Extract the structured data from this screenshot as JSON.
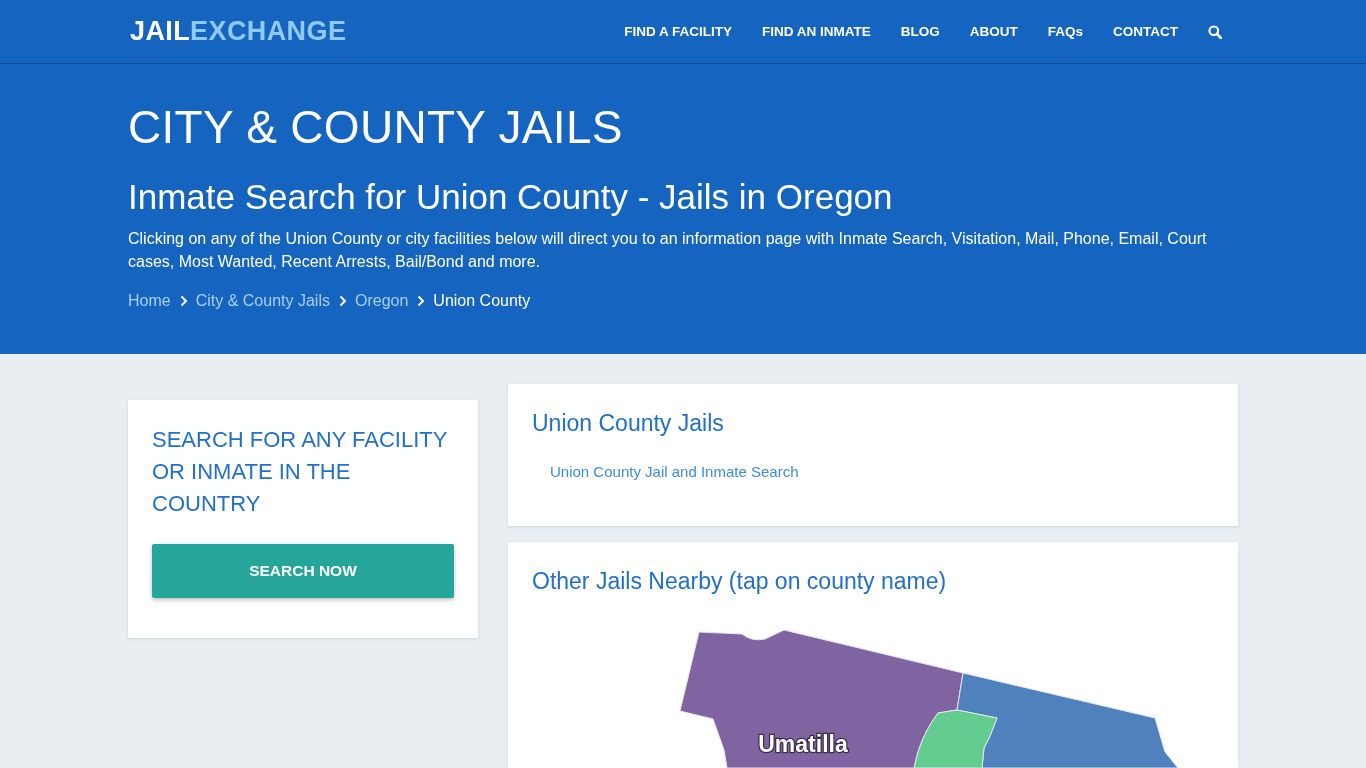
{
  "header": {
    "logo": {
      "first": "JAIL",
      "second": "EXCHANGE"
    },
    "nav": [
      "FIND A FACILITY",
      "FIND AN INMATE",
      "BLOG",
      "ABOUT",
      "FAQs",
      "CONTACT"
    ]
  },
  "hero": {
    "title": "CITY & COUNTY JAILS",
    "subtitle": "Inmate Search for Union County - Jails in Oregon",
    "description": "Clicking on any of the Union County or city facilities below will direct you to an information page with Inmate Search, Visitation, Mail, Phone, Email, Court cases, Most Wanted, Recent Arrests, Bail/Bond and more.",
    "breadcrumb": [
      {
        "label": "Home",
        "current": false
      },
      {
        "label": "City & County Jails",
        "current": false
      },
      {
        "label": "Oregon",
        "current": false
      },
      {
        "label": "Union County",
        "current": true
      }
    ]
  },
  "search_panel": {
    "title": "SEARCH FOR ANY FACILITY OR INMATE IN THE COUNTRY",
    "button": "SEARCH NOW"
  },
  "jails_panel": {
    "title": "Union County Jails",
    "links": [
      "Union County Jail and Inmate Search"
    ]
  },
  "nearby_panel": {
    "title": "Other Jails Nearby (tap on county name)",
    "map": {
      "regions": [
        {
          "name": "Umatilla",
          "color": "#8064a2"
        },
        {
          "color": "#4f81bd"
        },
        {
          "color": "#62cd8f"
        }
      ]
    }
  }
}
